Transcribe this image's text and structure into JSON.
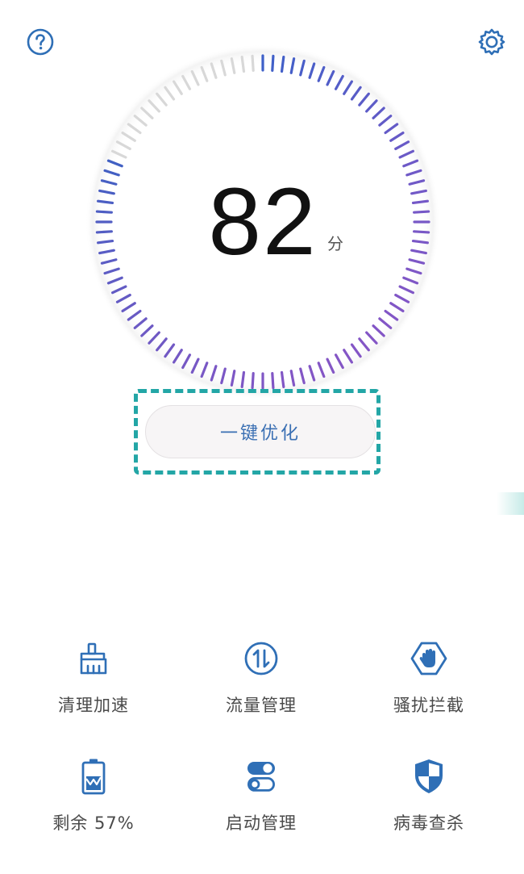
{
  "score": {
    "value": "82",
    "unit": "分",
    "progress": 0.82
  },
  "primary_action": {
    "label": "一键优化"
  },
  "header": {
    "help_icon": "help-circle-icon",
    "settings_icon": "gear-icon"
  },
  "tools": [
    {
      "label": "清理加速",
      "icon": "broom-icon"
    },
    {
      "label": "流量管理",
      "icon": "data-traffic-icon"
    },
    {
      "label": "骚扰拦截",
      "icon": "hand-block-icon"
    },
    {
      "label": "剩余 57%",
      "icon": "battery-icon",
      "battery_level": 0.57
    },
    {
      "label": "启动管理",
      "icon": "startup-toggle-icon"
    },
    {
      "label": "病毒查杀",
      "icon": "shield-icon"
    }
  ],
  "colors": {
    "accent": "#3a6fb3",
    "tick_active": "#4f6bc7",
    "tick_inactive": "#d8d8d8",
    "highlight": "#23a6a6"
  }
}
